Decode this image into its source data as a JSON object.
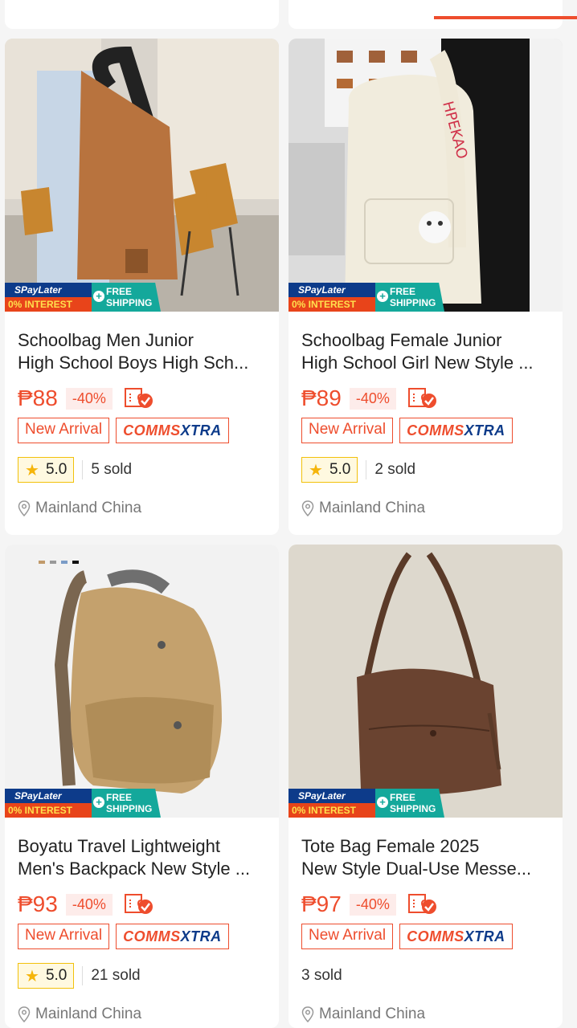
{
  "products": [
    {
      "title_line1": "Schoolbag Men Junior",
      "title_line2": "High School Boys High Sch...",
      "price": "₱88",
      "discount": "-40%",
      "tag_new": "New Arrival",
      "tag_comms_a": "COMMS",
      "tag_comms_b": "XTRA",
      "rating": "5.0",
      "sold": "5 sold",
      "location": "Mainland China",
      "promo": {
        "spay": "SPayLater",
        "interest": "0% INTEREST",
        "ship1": "FREE",
        "ship2": "SHIPPING"
      }
    },
    {
      "title_line1": "Schoolbag Female Junior",
      "title_line2": "High School Girl New Style ...",
      "price": "₱89",
      "discount": "-40%",
      "tag_new": "New Arrival",
      "tag_comms_a": "COMMS",
      "tag_comms_b": "XTRA",
      "rating": "5.0",
      "sold": "2 sold",
      "location": "Mainland China",
      "promo": {
        "spay": "SPayLater",
        "interest": "0% INTEREST",
        "ship1": "FREE",
        "ship2": "SHIPPING"
      }
    },
    {
      "title_line1": "Boyatu Travel Lightweight",
      "title_line2": "Men's Backpack New Style ...",
      "price": "₱93",
      "discount": "-40%",
      "tag_new": "New Arrival",
      "tag_comms_a": "COMMS",
      "tag_comms_b": "XTRA",
      "rating": "5.0",
      "sold": "21 sold",
      "location": "Mainland China",
      "promo": {
        "spay": "SPayLater",
        "interest": "0% INTEREST",
        "ship1": "FREE",
        "ship2": "SHIPPING"
      }
    },
    {
      "title_line1": "Tote Bag Female 2025",
      "title_line2": "New Style Dual-Use Messe...",
      "price": "₱97",
      "discount": "-40%",
      "tag_new": "New Arrival",
      "tag_comms_a": "COMMS",
      "tag_comms_b": "XTRA",
      "sold": "3 sold",
      "location": "Mainland China",
      "promo": {
        "spay": "SPayLater",
        "interest": "0% INTEREST",
        "ship1": "FREE",
        "ship2": "SHIPPING"
      }
    }
  ],
  "colors": {
    "accent": "#ee4d2d",
    "spay_blue": "#0d3b8a",
    "free_ship_teal": "#14a89b",
    "star": "#f5b50a"
  }
}
